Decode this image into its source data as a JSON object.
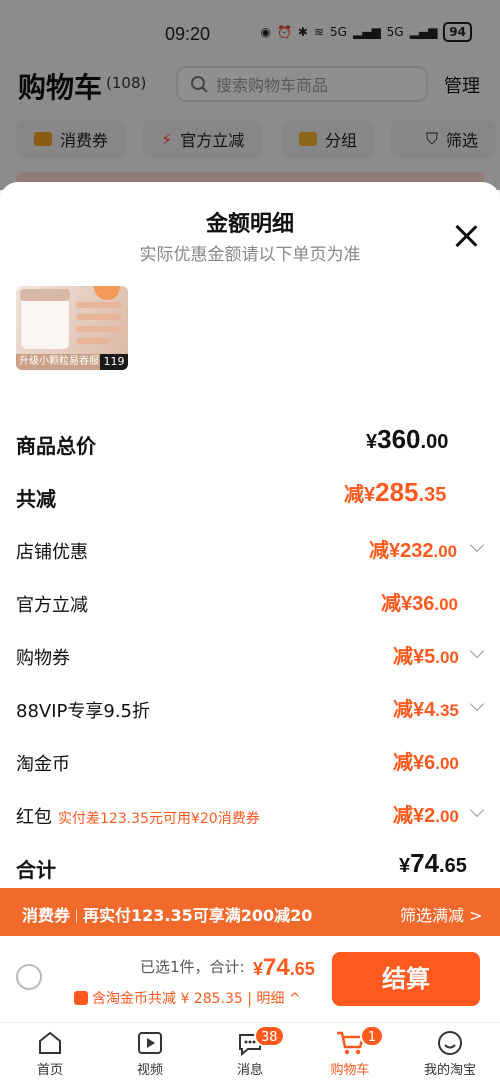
{
  "status_bar": {
    "time": "09:20",
    "network": "5G",
    "battery": "94"
  },
  "cart": {
    "title": "购物车",
    "count": "(108)",
    "search_placeholder": "搜索购物车商品",
    "manage_label": "管理",
    "chips": [
      "消费券",
      "官方立减",
      "分组",
      "筛选"
    ]
  },
  "sheet": {
    "title": "金额明细",
    "subtitle": "实际优惠金额请以下单页为准",
    "product": {
      "caption": "升级小颗粒易吞服",
      "price": "119"
    },
    "rows": [
      {
        "label": "商品总价",
        "prefix": "¥",
        "int": "360",
        "dec": ".00"
      },
      {
        "label": "共减",
        "prefix": "减¥",
        "int": "285",
        "dec": ".35"
      },
      {
        "label": "店铺优惠",
        "prefix": "减¥",
        "int": "232",
        "dec": ".00"
      },
      {
        "label": "官方立减",
        "prefix": "减¥",
        "int": "36",
        "dec": ".00"
      },
      {
        "label": "购物券",
        "prefix": "减¥",
        "int": "5",
        "dec": ".00"
      },
      {
        "label": "88VIP专享9.5折",
        "prefix": "减¥",
        "int": "4",
        "dec": ".35"
      },
      {
        "label": "淘金币",
        "prefix": "减¥",
        "int": "6",
        "dec": ".00"
      },
      {
        "label": "红包",
        "note": "实付差123.35元可用¥20消费券",
        "prefix": "减¥",
        "int": "2",
        "dec": ".00"
      },
      {
        "label": "合计",
        "prefix": "¥",
        "int": "74",
        "dec": ".65"
      }
    ]
  },
  "coupon_bar": {
    "tag": "消费券",
    "text": "再实付123.35可享满200减20",
    "action": "筛选满减 >"
  },
  "checkout": {
    "selected_label": "已选1件，合计:",
    "total_prefix": "¥",
    "total_int": "74",
    "total_dec": ".65",
    "sub": "含淘金币共减 ¥ 285.35 | 明细 ^",
    "pay_label": "结算"
  },
  "tabs": [
    {
      "label": "首页"
    },
    {
      "label": "视频"
    },
    {
      "label": "消息",
      "badge": "38"
    },
    {
      "label": "购物车",
      "badge": "1"
    },
    {
      "label": "我的淘宝"
    }
  ],
  "colors": {
    "accent": "#ff5a1e",
    "coupon_bar": "#f26a2b"
  }
}
